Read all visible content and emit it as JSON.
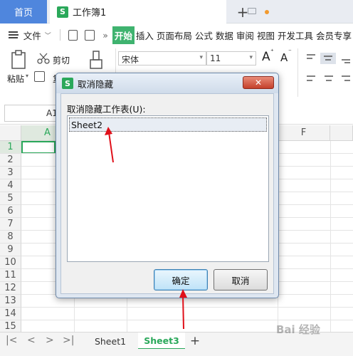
{
  "tabbar": {
    "home_label": "首页",
    "doc_logo": "S",
    "doc_title": "工作簿1",
    "add_label": "+"
  },
  "menu": {
    "file_label": "文件",
    "items": [
      "开始",
      "插入",
      "页面布局",
      "公式",
      "数据",
      "审阅",
      "视图",
      "开发工具",
      "会员专享"
    ],
    "more_label": "»"
  },
  "ribbon": {
    "cut_label": "剪切",
    "paste_label": "粘贴",
    "copy_label": "复",
    "font_name": "宋体",
    "font_size": "11",
    "grow_label": "A",
    "shrink_label": "A"
  },
  "formulabar": {
    "cell_ref": "A1"
  },
  "grid": {
    "columns": [
      "A",
      "F"
    ],
    "rows": [
      "1",
      "2",
      "3",
      "4",
      "5",
      "6",
      "7",
      "8",
      "9",
      "10",
      "11",
      "12",
      "13",
      "14",
      "15"
    ]
  },
  "sheets": {
    "tabs": [
      "Sheet1",
      "Sheet3"
    ],
    "active": "Sheet3",
    "add_label": "+",
    "active_color": "#2aa85a"
  },
  "dialog": {
    "logo": "S",
    "title": "取消隐藏",
    "close_label": "✕",
    "list_label": "取消隐藏工作表(U):",
    "list_items": [
      "Sheet2"
    ],
    "ok_label": "确定",
    "cancel_label": "取消"
  },
  "annotation_color": "#e0101a",
  "watermark": "Bai 经验"
}
